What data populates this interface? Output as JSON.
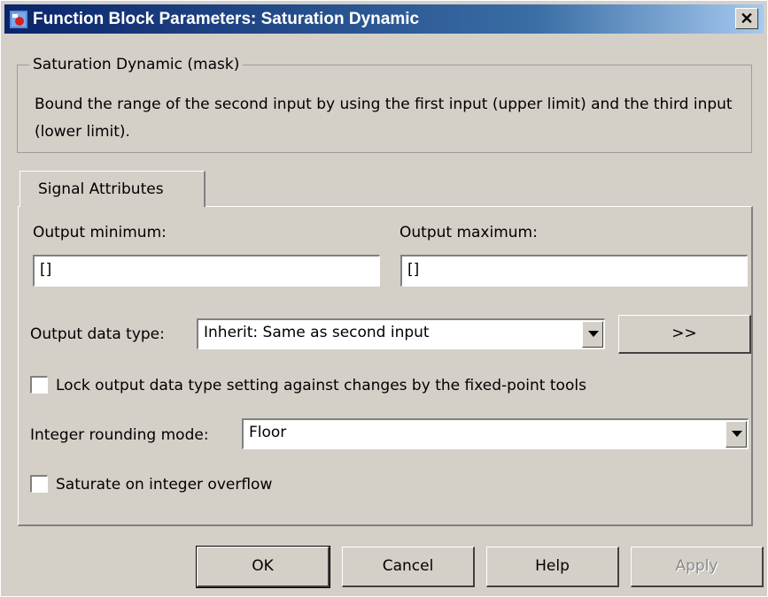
{
  "window": {
    "title": "Function Block Parameters: Saturation Dynamic",
    "close_glyph": "✕"
  },
  "mask": {
    "legend": "Saturation Dynamic (mask)",
    "description": "Bound the range of the second input by using the first input (upper limit) and the third input (lower limit)."
  },
  "tabs": [
    {
      "label": "Signal Attributes",
      "selected": true
    }
  ],
  "fields": {
    "output_minimum": {
      "label": "Output minimum:",
      "value": "[]"
    },
    "output_maximum": {
      "label": "Output maximum:",
      "value": "[]"
    },
    "output_data_type": {
      "label": "Output data type:",
      "value": "Inherit: Same as second input",
      "assistant_label": ">>"
    },
    "lock_output": {
      "label": "Lock output data type setting against changes by the fixed-point tools",
      "checked": false
    },
    "rounding_mode": {
      "label": "Integer rounding mode:",
      "value": "Floor"
    },
    "saturate": {
      "label": "Saturate on integer overflow",
      "checked": false
    }
  },
  "buttons": {
    "ok": "OK",
    "cancel": "Cancel",
    "help": "Help",
    "apply": "Apply"
  },
  "icons": {
    "app": "simulink-block-icon",
    "close": "close-icon",
    "dropdown": "chevron-down-icon"
  },
  "colors": {
    "titlebar_start": "#0a246a",
    "titlebar_end": "#a6caf0",
    "dialog_bg": "#d4d0c8"
  }
}
